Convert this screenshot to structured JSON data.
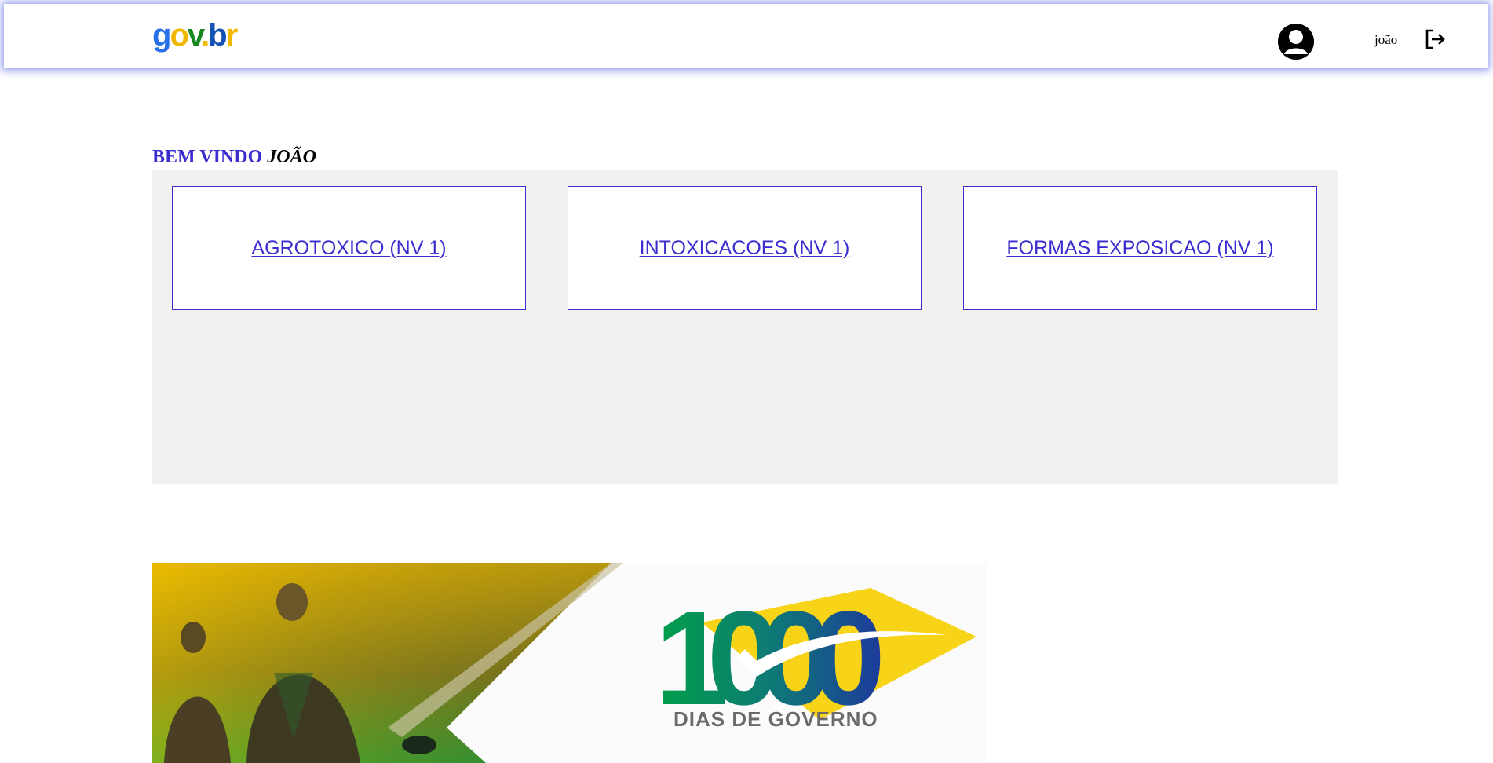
{
  "header": {
    "logo": {
      "g": "g",
      "o": "o",
      "v": "v",
      "dot": ".",
      "b": "b",
      "r": "r"
    },
    "user_name": "joão",
    "icons": {
      "avatar": "user-avatar-icon",
      "logout": "logout-icon"
    }
  },
  "welcome": {
    "prefix": "BEM VINDO",
    "name": "JOÃO"
  },
  "cards": [
    {
      "label": "AGROTOXICO (NV 1)"
    },
    {
      "label": "INTOXICACOES (NV 1)"
    },
    {
      "label": "FORMAS EXPOSICAO (NV 1)"
    }
  ],
  "banner": {
    "number": "1000",
    "caption": "DIAS DE GOVERNO"
  },
  "colors": {
    "accent": "#3b2ed0",
    "panel_bg": "#f1f1f1",
    "brazil_green": "#00a04a",
    "brazil_yellow": "#f7d417",
    "brazil_blue": "#1d3b9b"
  }
}
